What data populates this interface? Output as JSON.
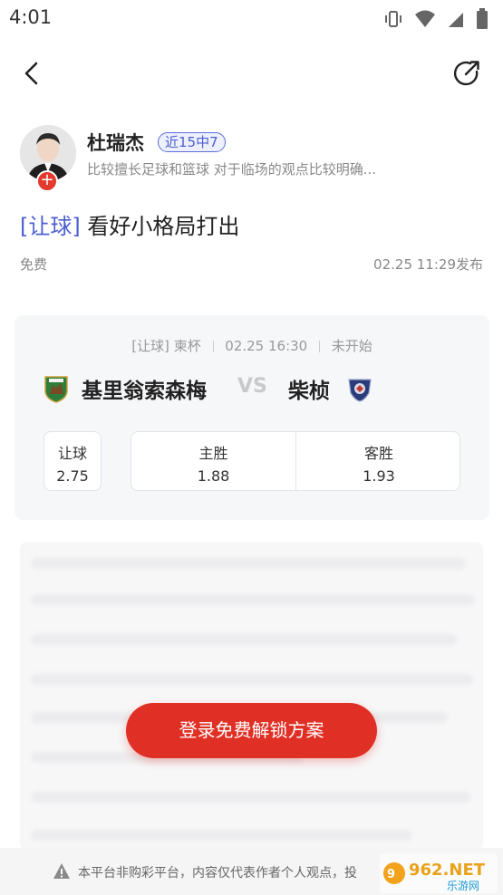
{
  "status_bar": {
    "time": "4:01",
    "icons": [
      "vibrate-icon",
      "wifi-icon",
      "signal-icon",
      "battery-icon"
    ]
  },
  "topbar": {
    "back_icon": "back-arrow-icon",
    "share_icon": "share-icon"
  },
  "author": {
    "name": "杜瑞杰",
    "record_badge": "近15中7",
    "description": "比较擅长足球和篮球 对于临场的观点比较明确...",
    "follow_icon": "plus-icon",
    "follow_symbol": "+"
  },
  "post": {
    "tag": "[让球]",
    "title": "看好小格局打出",
    "price": "免费",
    "publish_time": "02.25 11:29发布"
  },
  "match": {
    "meta": {
      "type": "[让球]",
      "league": "柬杯",
      "datetime": "02.25 16:30",
      "status": "未开始"
    },
    "home_team": "基里翁索森梅",
    "vs_label": "VS",
    "away_team": "柴桢",
    "handicap": {
      "label": "让球",
      "value": "2.75"
    },
    "odds": [
      {
        "label": "主胜",
        "value": "1.88"
      },
      {
        "label": "客胜",
        "value": "1.93"
      }
    ]
  },
  "locked_content": {
    "unlock_button": "登录免费解锁方案"
  },
  "disclaimer": {
    "text": "本平台非购彩平台，内容仅代表作者个人观点，投"
  },
  "watermark": {
    "brand": "962.NET",
    "sub": "乐游网"
  },
  "colors": {
    "accent_blue": "#4c5fd0",
    "accent_red": "#e02f24",
    "muted_text": "#888888"
  }
}
